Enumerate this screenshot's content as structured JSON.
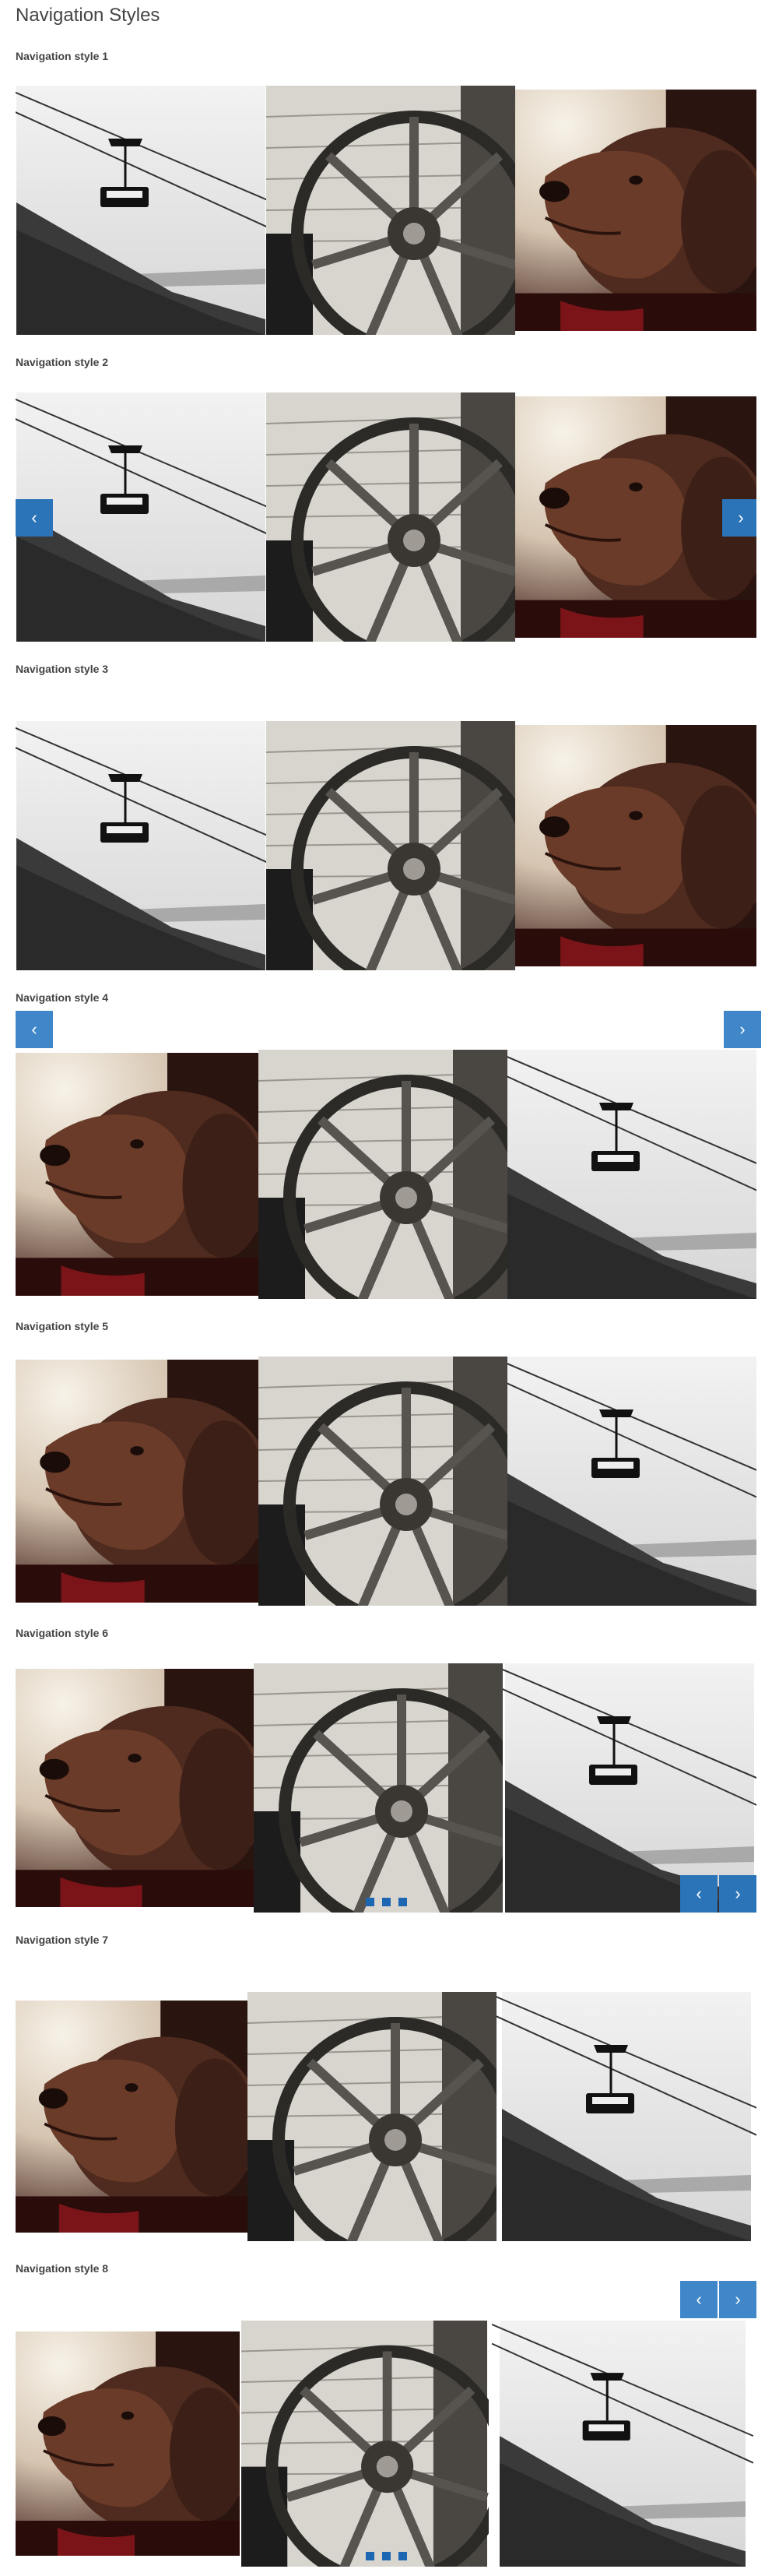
{
  "page_title": "Navigation Styles",
  "sections": [
    {
      "title": "Navigation style 1"
    },
    {
      "title": "Navigation style 2"
    },
    {
      "title": "Navigation style 3"
    },
    {
      "title": "Navigation style 4"
    },
    {
      "title": "Navigation style 5"
    },
    {
      "title": "Navigation style 6"
    },
    {
      "title": "Navigation style 7"
    },
    {
      "title": "Navigation style 8"
    }
  ],
  "nav": {
    "prev_symbol": "‹",
    "next_symbol": "›"
  },
  "colors": {
    "button": "#3f87c9",
    "button_dark": "#2b74b8",
    "dot": "#1d66b1"
  },
  "icons": {
    "prev": "chevron-left-icon",
    "next": "chevron-right-icon"
  }
}
